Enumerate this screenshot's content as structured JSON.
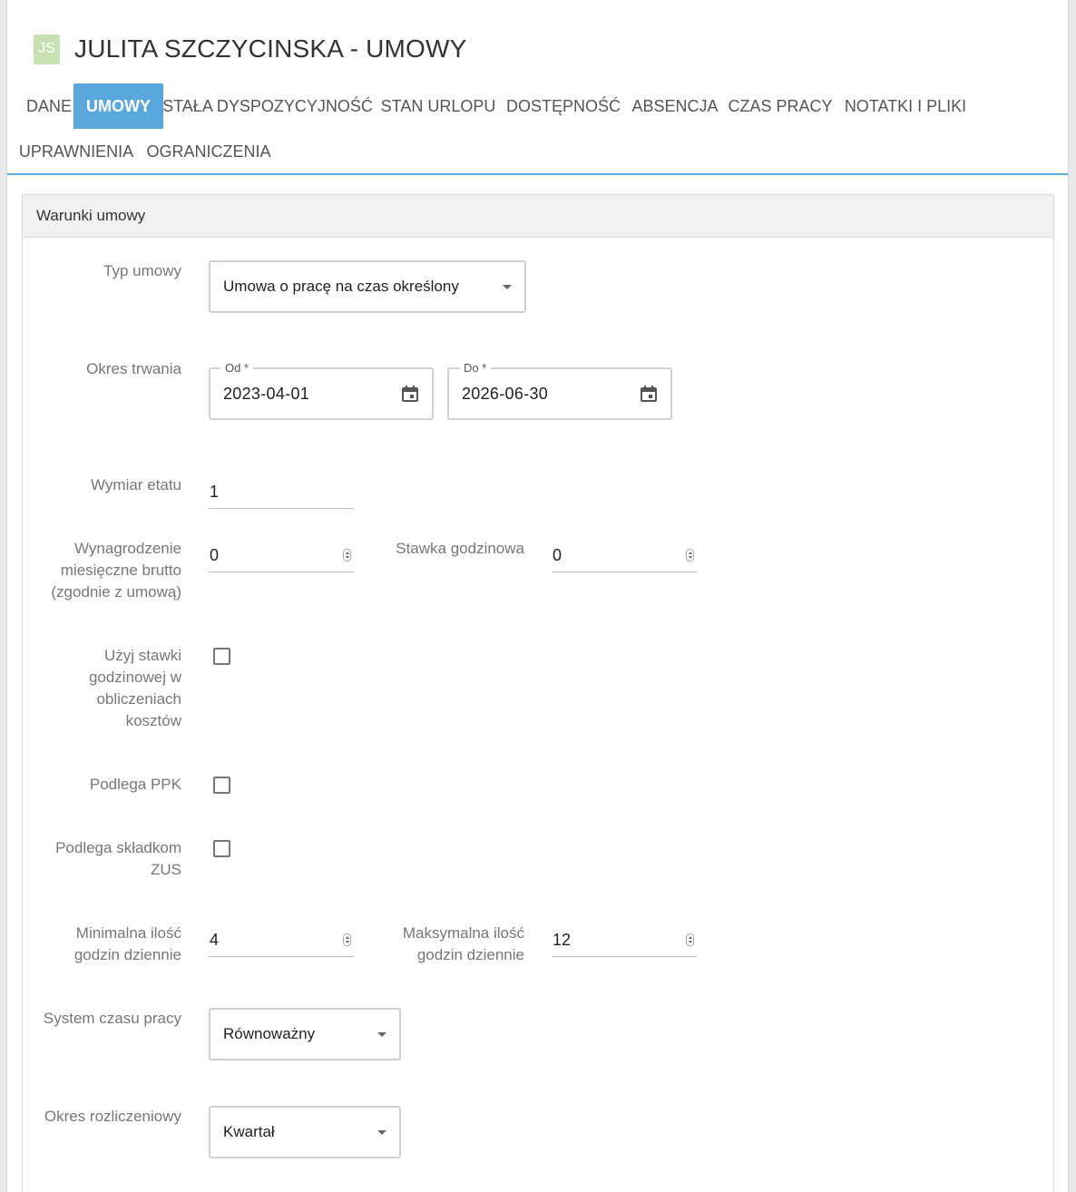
{
  "header": {
    "avatar_initials": "JS",
    "title": "JULITA SZCZYCINSKA - UMOWY",
    "avatar_color": "#c8e1b3"
  },
  "tabs": [
    {
      "label": "DANE",
      "active": false
    },
    {
      "label": "UMOWY",
      "active": true
    },
    {
      "label": "STAŁA DYSPOZYCYJNOŚĆ",
      "active": false
    },
    {
      "label": "STAN URLOPU",
      "active": false
    },
    {
      "label": "DOSTĘPNOŚĆ",
      "active": false
    },
    {
      "label": "ABSENCJA",
      "active": false
    },
    {
      "label": "CZAS PRACY",
      "active": false
    },
    {
      "label": "NOTATKI I PLIKI",
      "active": false
    },
    {
      "label": "UPRAWNIENIA",
      "active": false
    },
    {
      "label": "OGRANICZENIA",
      "active": false
    }
  ],
  "accent_color": "#5aa7dd",
  "panel": {
    "title": "Warunki umowy",
    "contract_type": {
      "label": "Typ umowy",
      "value": "Umowa o pracę na czas określony"
    },
    "period": {
      "label": "Okres trwania",
      "from": {
        "label": "Od",
        "required_mark": "*",
        "value": "2023-04-01"
      },
      "to": {
        "label": "Do",
        "required_mark": "*",
        "value": "2026-06-30"
      }
    },
    "fte": {
      "label": "Wymiar etatu",
      "value": "1"
    },
    "monthly_salary": {
      "label_lines": [
        "Wynagrodzenie",
        "miesięczne brutto",
        "(zgodnie z umową)"
      ],
      "value": "0"
    },
    "hourly_rate": {
      "label": "Stawka godzinowa",
      "value": "0"
    },
    "use_hourly_rate": {
      "label_lines": [
        "Użyj stawki",
        "godzinowej w",
        "obliczeniach",
        "kosztów"
      ],
      "checked": false
    },
    "ppk": {
      "label": "Podlega PPK",
      "checked": false
    },
    "zus": {
      "label_lines": [
        "Podlega składkom",
        "ZUS"
      ],
      "checked": false
    },
    "min_hours": {
      "label_lines": [
        "Minimalna ilość",
        "godzin dziennie"
      ],
      "value": "4"
    },
    "max_hours": {
      "label_lines": [
        "Maksymalna ilość",
        "godzin dziennie"
      ],
      "value": "12"
    },
    "work_time_system": {
      "label": "System czasu pracy",
      "value": "Równoważny"
    },
    "settlement_period": {
      "label": "Okres rozliczeniowy",
      "value": "Kwartał"
    }
  }
}
